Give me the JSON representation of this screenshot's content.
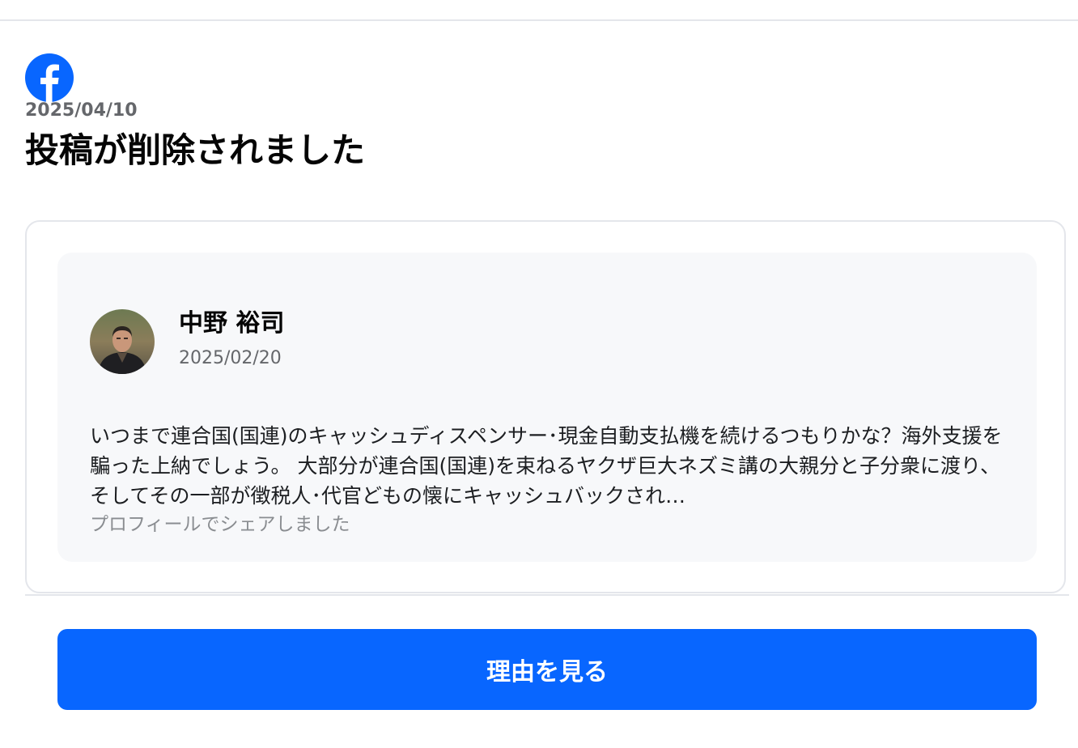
{
  "notice": {
    "date": "2025/04/10",
    "title": "投稿が削除されました"
  },
  "post": {
    "author_name": "中野 裕司",
    "date": "2025/02/20",
    "text": "いつまで連合国(国連)のキャッシュディスペンサー･現金自動支払機を続けるつもりかな？海外支援を騙った上納でしょう。 大部分が連合国(国連)を束ねるヤクザ巨大ネズミ講の大親分と子分衆に渡り、そしてその一部が徴税人･代官どもの懐にキャッシュバックされ…",
    "share_note": "プロフィールでシェアしました"
  },
  "actions": {
    "view_reason_label": "理由を見る"
  },
  "icons": {
    "brand": "facebook-logo-icon",
    "avatar": "profile-photo"
  },
  "colors": {
    "brand_blue": "#0866ff",
    "preview_bg": "#f7f8fa",
    "secondary_text": "#65676b",
    "border": "#e4e6eb"
  }
}
